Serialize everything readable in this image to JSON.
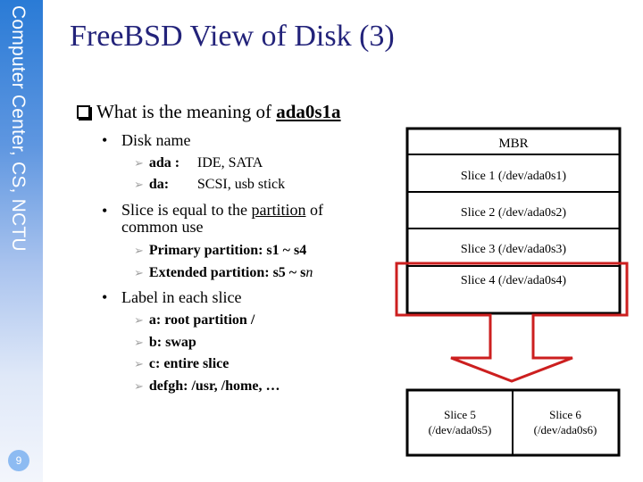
{
  "sidebar": {
    "org_label": "Computer Center, CS, NCTU",
    "page_number": "9"
  },
  "title": "FreeBSD View of Disk (3)",
  "main_question": {
    "prefix": "What is the meaning of ",
    "term": "ada0s1a"
  },
  "bullets": [
    {
      "label": "Disk name",
      "sub": [
        {
          "key": "ada :",
          "value": "IDE, SATA"
        },
        {
          "key": "da:",
          "value": "SCSI, usb stick"
        }
      ]
    },
    {
      "label_before": "Slice is equal to the ",
      "label_underlined": "partition",
      "label_after": " of",
      "label_line2": "common use",
      "sub": [
        {
          "text": "Primary partition: s1 ~ s4"
        },
        {
          "text_before": "Extended partition: s5 ~ s",
          "text_italic": "n"
        }
      ]
    },
    {
      "label": "Label in each slice",
      "sub": [
        {
          "text": "a: root partition /"
        },
        {
          "text": "b: swap"
        },
        {
          "text": "c: entire slice"
        },
        {
          "text": "defgh: /usr, /home, …"
        }
      ]
    }
  ],
  "diagram": {
    "mbr_table": [
      "MBR",
      "Slice 1 (/dev/ada0s1)",
      "Slice 2 (/dev/ada0s2)",
      "Slice 3 (/dev/ada0s3)",
      "Slice 4 (/dev/ada0s4)"
    ],
    "extended": [
      {
        "name": "Slice 5",
        "device": "(/dev/ada0s5)"
      },
      {
        "name": "Slice 6",
        "device": "(/dev/ada0s6)"
      }
    ],
    "highlight_color": "#cc1f1f"
  }
}
